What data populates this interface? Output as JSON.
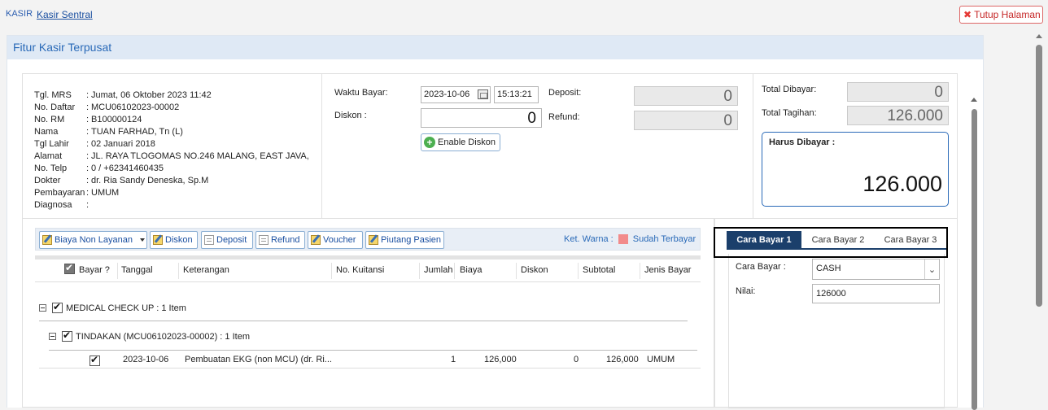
{
  "nav": {
    "kasir": "KASIR",
    "sentral": "Kasir Sentral",
    "close": "Tutup Halaman"
  },
  "panel_title": "Fitur Kasir Terpusat",
  "patient": {
    "rows": [
      {
        "label": "Tgl. MRS",
        "value": "Jumat, 06 Oktober 2023 11:42"
      },
      {
        "label": "No. Daftar",
        "value": "MCU06102023-00002"
      },
      {
        "label": "No. RM",
        "value": "B100000124"
      },
      {
        "label": "Nama",
        "value": "TUAN FARHAD, Tn (L)"
      },
      {
        "label": "Tgl Lahir",
        "value": "02 Januari 2018"
      },
      {
        "label": "Alamat",
        "value": "JL. RAYA TLOGOMAS NO.246 MALANG, EAST JAVA,"
      },
      {
        "label": "No. Telp",
        "value": "0 / +62341460435"
      },
      {
        "label": "Dokter",
        "value": "dr. Ria Sandy Deneska, Sp.M"
      },
      {
        "label": "Pembayaran",
        "value": "UMUM"
      },
      {
        "label": "Diagnosa",
        "value": ""
      }
    ]
  },
  "payment": {
    "waktu_label": "Waktu Bayar:",
    "date": "2023-10-06",
    "time": "15:13:21",
    "diskon_label": "Diskon :",
    "diskon_value": "0",
    "enable_diskon": "Enable Diskon",
    "deposit_label": "Deposit:",
    "deposit_value": "0",
    "refund_label": "Refund:",
    "refund_value": "0"
  },
  "totals": {
    "dibayar_label": "Total Dibayar:",
    "dibayar_value": "0",
    "tagihan_label": "Total Tagihan:",
    "tagihan_value": "126.000",
    "harus_label": "Harus Dibayar :",
    "harus_value": "126.000"
  },
  "toolbar": {
    "biaya_non_layanan": "Biaya Non Layanan",
    "diskon": "Diskon",
    "deposit": "Deposit",
    "refund": "Refund",
    "voucher": "Voucher",
    "piutang": "Piutang Pasien",
    "ket_warna": "Ket. Warna :",
    "sudah_terbayar": "Sudah Terbayar"
  },
  "grid": {
    "columns": [
      "Bayar ?",
      "Tanggal",
      "Keterangan",
      "No. Kuitansi",
      "Jumlah",
      "Biaya",
      "Diskon",
      "Subtotal",
      "Jenis Bayar"
    ],
    "group1": "MEDICAL CHECK UP : 1 Item",
    "group2": "TINDAKAN (MCU06102023-00002) : 1 Item",
    "rows": [
      {
        "tanggal": "2023-10-06",
        "keterangan": "Pembuatan EKG (non MCU) (dr. Ri...",
        "jumlah": "1",
        "biaya": "126,000",
        "diskon": "0",
        "subtotal": "126,000",
        "jenis": "UMUM"
      }
    ]
  },
  "methods": {
    "tabs": [
      "Cara Bayar 1",
      "Cara Bayar 2",
      "Cara Bayar 3"
    ],
    "cara_label": "Cara Bayar :",
    "cara_value": "CASH",
    "nilai_label": "Nilai:",
    "nilai_value": "126000"
  },
  "colors": {
    "accent": "#2a6ab8",
    "tab_active": "#1b3f6b",
    "paid_swatch": "#f28b8b",
    "close_red": "#c62828"
  }
}
